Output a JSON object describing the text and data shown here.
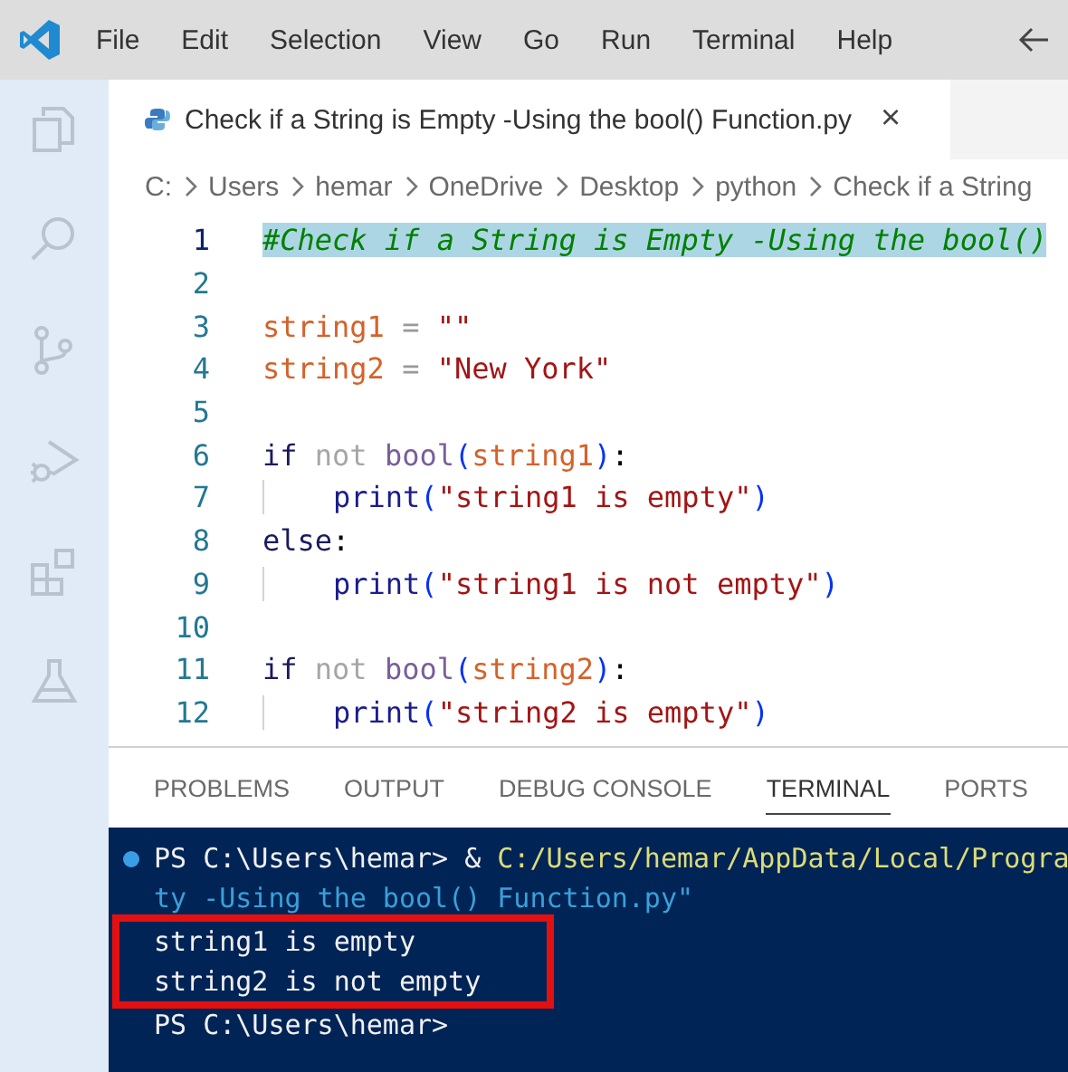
{
  "menu_bar": {
    "items": [
      "File",
      "Edit",
      "Selection",
      "View",
      "Go",
      "Run",
      "Terminal",
      "Help"
    ]
  },
  "activity_bar": {
    "items": [
      {
        "kind": "files",
        "selected": false
      },
      {
        "kind": "search",
        "selected": false
      },
      {
        "kind": "source_control",
        "selected": false
      },
      {
        "kind": "run_debug",
        "selected": false
      },
      {
        "kind": "extensions",
        "selected": false
      },
      {
        "kind": "testing",
        "selected": false
      }
    ]
  },
  "editor_tab": {
    "title": "Check if a String is Empty -Using the bool() Function.py",
    "close": "×"
  },
  "breadcrumb": [
    "C:",
    "Users",
    "hemar",
    "OneDrive",
    "Desktop",
    "python",
    "Check if a String"
  ],
  "code_lines": [
    {
      "number": "1",
      "active": true,
      "tokens": [
        {
          "kind": "comment",
          "text": "#Check if a String is Empty -Using the bool()"
        }
      ]
    },
    {
      "number": "2",
      "active": false
    },
    {
      "number": "3",
      "active": false,
      "tokens": [
        {
          "kind": "var",
          "text": "string1"
        },
        {
          "kind": "op",
          "text": " = "
        },
        {
          "kind": "str",
          "text": "\"\""
        }
      ]
    },
    {
      "number": "4",
      "active": false,
      "tokens": [
        {
          "kind": "var",
          "text": "string2"
        },
        {
          "kind": "op",
          "text": " = "
        },
        {
          "kind": "str",
          "text": "\"New York\""
        }
      ]
    },
    {
      "number": "5",
      "active": false
    },
    {
      "number": "6",
      "active": false,
      "tokens": [
        {
          "kind": "kw",
          "text": "if "
        },
        {
          "kind": "dim",
          "text": "not "
        },
        {
          "kind": "func",
          "text": "bool"
        },
        {
          "kind": "paren",
          "text": "("
        },
        {
          "kind": "var",
          "text": "string1"
        },
        {
          "kind": "paren",
          "text": ")"
        },
        {
          "kind": "punct",
          "text": ":"
        }
      ]
    },
    {
      "number": "7",
      "active": false,
      "indented": true,
      "tokens": [
        {
          "kind": "call",
          "text": "print"
        },
        {
          "kind": "paren",
          "text": "("
        },
        {
          "kind": "str",
          "text": "\"string1 is empty\""
        },
        {
          "kind": "paren",
          "text": ")"
        }
      ]
    },
    {
      "number": "8",
      "active": false,
      "tokens": [
        {
          "kind": "kw",
          "text": "else"
        },
        {
          "kind": "punct",
          "text": ":"
        }
      ]
    },
    {
      "number": "9",
      "active": false,
      "indented": true,
      "tokens": [
        {
          "kind": "call",
          "text": "print"
        },
        {
          "kind": "paren",
          "text": "("
        },
        {
          "kind": "str",
          "text": "\"string1 is not empty\""
        },
        {
          "kind": "paren",
          "text": ")"
        }
      ]
    },
    {
      "number": "10",
      "active": false
    },
    {
      "number": "11",
      "active": false,
      "tokens": [
        {
          "kind": "kw",
          "text": "if "
        },
        {
          "kind": "dim",
          "text": "not "
        },
        {
          "kind": "func",
          "text": "bool"
        },
        {
          "kind": "paren",
          "text": "("
        },
        {
          "kind": "var",
          "text": "string2"
        },
        {
          "kind": "paren",
          "text": ")"
        },
        {
          "kind": "punct",
          "text": ":"
        }
      ]
    },
    {
      "number": "12",
      "active": false,
      "indented": true,
      "tokens": [
        {
          "kind": "call",
          "text": "print"
        },
        {
          "kind": "paren",
          "text": "("
        },
        {
          "kind": "str",
          "text": "\"string2 is empty\""
        },
        {
          "kind": "paren",
          "text": ")"
        }
      ]
    }
  ],
  "panel_tabs": [
    {
      "label": "PROBLEMS",
      "selected": false
    },
    {
      "label": "OUTPUT",
      "selected": false
    },
    {
      "label": "DEBUG CONSOLE",
      "selected": false
    },
    {
      "label": "TERMINAL",
      "selected": true
    },
    {
      "label": "PORTS",
      "selected": false
    }
  ],
  "terminal_lines": [
    {
      "status_dot": true,
      "tokens": [
        {
          "kind": "plain",
          "text": "PS C:\\Users\\hemar> & "
        },
        {
          "kind": "path",
          "text": "C:/Users/hemar/AppData/Local/Progra"
        }
      ]
    },
    {
      "tokens": [
        {
          "kind": "quoted",
          "text": "ty -Using the bool() Function.py\""
        }
      ]
    },
    {
      "highlighted": true,
      "tokens": [
        {
          "kind": "plain",
          "text": "string1 is empty"
        }
      ]
    },
    {
      "highlighted": true,
      "tokens": [
        {
          "kind": "plain",
          "text": "string2 is not empty"
        }
      ]
    },
    {
      "tokens": [
        {
          "kind": "plain",
          "text": "PS C:\\Users\\hemar>"
        }
      ]
    }
  ]
}
